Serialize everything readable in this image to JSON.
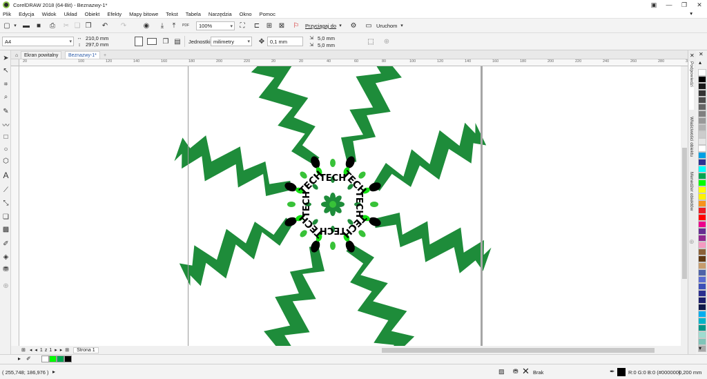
{
  "app": {
    "title": "CorelDRAW 2018 (64-Bit) - Beznazwy-1*"
  },
  "menu": [
    "Plik",
    "Edycja",
    "Widok",
    "Układ",
    "Obiekt",
    "Efekty",
    "Mapy bitowe",
    "Tekst",
    "Tabela",
    "Narzędzia",
    "Okno",
    "Pomoc"
  ],
  "toolbar1": {
    "zoom": "100%",
    "snap_label": "Przyciągaj do",
    "launch_label": "Uruchom",
    "pdf_label": "PDF"
  },
  "toolbar2": {
    "page_size": "A4",
    "width": "210,0 mm",
    "height": "297,0 mm",
    "units_label": "Jednostki:",
    "units_value": "milimetry",
    "nudge": "0,1 mm",
    "dup_x": "5,0 mm",
    "dup_y": "5,0 mm"
  },
  "tabs": {
    "welcome": "Ekran powitalny",
    "doc": "Beznazwy-1*"
  },
  "ruler_labels": [
    "20",
    "",
    "100",
    "120",
    "140",
    "160",
    "180",
    "200",
    "220",
    "20",
    "20",
    "40",
    "60",
    "80",
    "100",
    "120",
    "140",
    "160",
    "180",
    "200",
    "220",
    "240",
    "260",
    "280",
    "300",
    "320",
    "340"
  ],
  "pagenav": {
    "current": "1",
    "of": "z",
    "total": "1",
    "page_tab": "Strona 1"
  },
  "docker": {
    "tips": "Podpowiedzi",
    "props": "Właściwości obiektu",
    "manager": "Menedżer obiektów"
  },
  "palette_colors": [
    "#ffffff",
    "#000000",
    "#1a1a1a",
    "#333333",
    "#4d4d4d",
    "#666666",
    "#808080",
    "#999999",
    "#b3b3b3",
    "#cccccc",
    "#e6e6e6",
    "#ffffff",
    "#00a0e3",
    "#2e3192",
    "#00ffff",
    "#00a651",
    "#00ff00",
    "#ffff00",
    "#fff200",
    "#f7941d",
    "#ed1c24",
    "#ff0000",
    "#ec008c",
    "#662d91",
    "#92278f",
    "#f49ac1",
    "#8c6239",
    "#603913",
    "#c69c6d",
    "#4f63a8",
    "#5a6bd0",
    "#3c4fb8",
    "#2b2f8f",
    "#1b1f6b",
    "#0f1a4a",
    "#00aeef",
    "#00b4c8",
    "#009688",
    "#9edcd0",
    "#7fc4b8",
    "#a9a9a9"
  ],
  "doc_palette": [
    "#ffffff",
    "#00ff00",
    "#00a651",
    "#000000"
  ],
  "status": {
    "coords": "( 255,748; 186,976 )",
    "fill_label": "Brak",
    "outline_color": "R:0 G:0 B:0 (#000000)",
    "outline_width": "0,200 mm"
  },
  "artwork": {
    "word": "TECH",
    "colors": {
      "dark": "#1e8c3a",
      "bright": "#13e013",
      "mid": "#38c238",
      "black": "#000000"
    }
  }
}
